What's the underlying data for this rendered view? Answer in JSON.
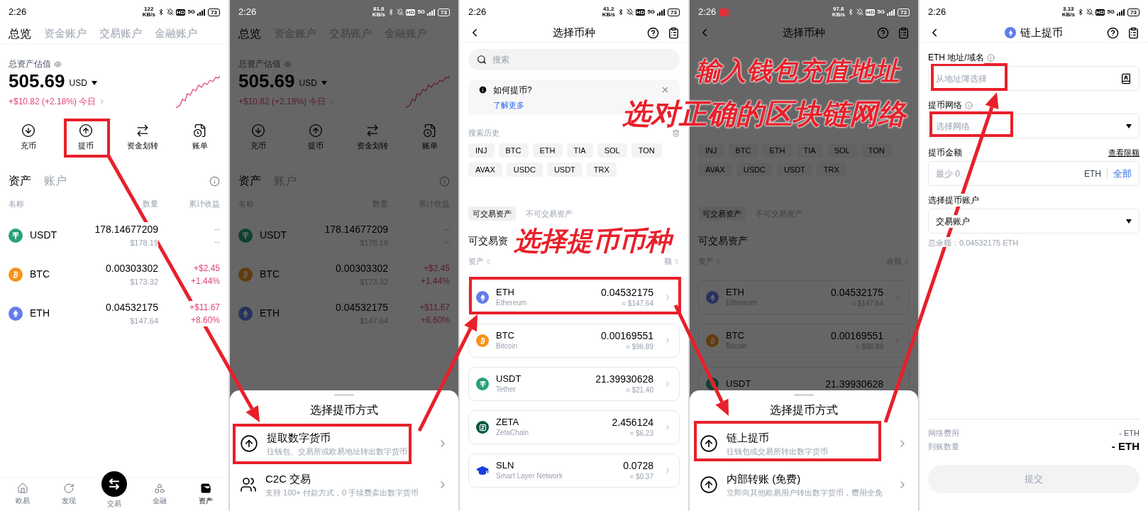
{
  "annotations": [
    {
      "text": "输入钱包充值地址"
    },
    {
      "text": "选对正确的区块链网络"
    },
    {
      "text": "选择提币币种"
    }
  ],
  "screens": [
    {
      "kind": "assets",
      "dimmed": false,
      "status_bar": {
        "time": "2:26",
        "notification": false,
        "speed": "122",
        "speed_unit": "KB/s",
        "hd": "HD",
        "network": "5G",
        "battery": "73"
      },
      "tabs": [
        {
          "label": "总览",
          "selected": true
        },
        {
          "label": "资金账户",
          "selected": false
        },
        {
          "label": "交易账户",
          "selected": false
        },
        {
          "label": "金融账户",
          "selected": false
        }
      ],
      "total_label": "总资产估值",
      "total_value": "505.69",
      "currency": "USD",
      "change": "+$10.82 (+2.18%) 今日",
      "actions": [
        {
          "label": "充币",
          "kind": "deposit"
        },
        {
          "label": "提币",
          "kind": "withdraw"
        },
        {
          "label": "资金划转",
          "kind": "transfer"
        },
        {
          "label": "账单",
          "kind": "bill"
        }
      ],
      "asset_tabs": [
        {
          "label": "资产",
          "selected": true
        },
        {
          "label": "账户",
          "selected": false
        }
      ],
      "columns": [
        "名称",
        "数量",
        "累计收益"
      ],
      "rows": [
        {
          "symbol": "USDT",
          "kind": "tether",
          "amount": "178.14677209",
          "value": "$178.19",
          "gain": false,
          "pnl": "--",
          "pnl_pct": "--"
        },
        {
          "symbol": "BTC",
          "kind": "bitcoin",
          "amount": "0.00303302",
          "value": "$173.32",
          "gain": true,
          "pnl": "+$2.45",
          "pnl_pct": "+1.44%"
        },
        {
          "symbol": "ETH",
          "kind": "ethereum",
          "amount": "0.04532175",
          "value": "$147.64",
          "gain": true,
          "pnl": "+$11.67",
          "pnl_pct": "+8.60%"
        }
      ],
      "bottom_nav": [
        {
          "label": "欧易",
          "kind": "home",
          "selected": false
        },
        {
          "label": "发现",
          "kind": "discover",
          "selected": false
        },
        {
          "label": "交易",
          "kind": "trade",
          "selected": false
        },
        {
          "label": "金融",
          "kind": "finance",
          "selected": false
        },
        {
          "label": "资产",
          "kind": "assets",
          "selected": true
        }
      ]
    },
    {
      "kind": "assets",
      "dimmed": true,
      "status_bar": {
        "time": "2:26",
        "notification": false,
        "speed": "81.8",
        "speed_unit": "KB/s",
        "hd": "HD",
        "network": "5G",
        "battery": "73"
      },
      "tabs": [
        {
          "label": "总览",
          "selected": true
        },
        {
          "label": "资金账户",
          "selected": false
        },
        {
          "label": "交易账户",
          "selected": false
        },
        {
          "label": "金融账户",
          "selected": false
        }
      ],
      "total_label": "总资产估值",
      "total_value": "505.69",
      "currency": "USD",
      "change": "+$10.82 (+2.18%) 今日",
      "actions": [
        {
          "label": "充币",
          "kind": "deposit"
        },
        {
          "label": "提币",
          "kind": "withdraw"
        },
        {
          "label": "资金划转",
          "kind": "transfer"
        },
        {
          "label": "账单",
          "kind": "bill"
        }
      ],
      "asset_tabs": [
        {
          "label": "资产",
          "selected": true
        },
        {
          "label": "账户",
          "selected": false
        }
      ],
      "columns": [
        "名称",
        "数量",
        "累计收益"
      ],
      "rows": [
        {
          "symbol": "USDT",
          "kind": "tether",
          "amount": "178.14677209",
          "value": "$178.19",
          "gain": false,
          "pnl": "--",
          "pnl_pct": "--"
        },
        {
          "symbol": "BTC",
          "kind": "bitcoin",
          "amount": "0.00303302",
          "value": "$173.32",
          "gain": true,
          "pnl": "+$2.45",
          "pnl_pct": "+1.44%"
        },
        {
          "symbol": "ETH",
          "kind": "ethereum",
          "amount": "0.04532175",
          "value": "$147.64",
          "gain": true,
          "pnl": "+$11.67",
          "pnl_pct": "+8.60%"
        }
      ],
      "sheet": {
        "title": "选择提币方式",
        "options": [
          {
            "kind": "upload",
            "title": "提取数字货币",
            "desc": "往钱包、交易所或欧易地址转出数字货币"
          },
          {
            "kind": "people",
            "title": "C2C 交易",
            "desc": "支持 100+ 付款方式，0 手续费卖出数字货币"
          }
        ]
      }
    },
    {
      "kind": "coin_select",
      "dimmed": false,
      "status_bar": {
        "time": "2:26",
        "notification": false,
        "speed": "41.2",
        "speed_unit": "KB/s",
        "hd": "HD",
        "network": "5G",
        "battery": "73"
      },
      "title": "选择币种",
      "search_placeholder": "搜索",
      "banner": {
        "title": "如何提币?",
        "link": "了解更多"
      },
      "history_label": "搜索历史",
      "chips": [
        "INJ",
        "BTC",
        "ETH",
        "TIA",
        "SOL",
        "TON",
        "AVAX",
        "USDC",
        "USDT",
        "TRX"
      ],
      "filters": [
        {
          "label": "可交易资产",
          "selected": true
        },
        {
          "label": "不可交易资产",
          "selected": false
        }
      ],
      "section_title": "可交易资",
      "columns": [
        "资产",
        "额"
      ],
      "coins": [
        {
          "symbol": "ETH",
          "name": "Ethereum",
          "kind": "ethereum",
          "amount": "0.04532175",
          "value": "≈ $147.64"
        },
        {
          "symbol": "BTC",
          "name": "Bitcoin",
          "kind": "bitcoin",
          "amount": "0.00169551",
          "value": "≈ $96.89"
        },
        {
          "symbol": "USDT",
          "name": "Tether",
          "kind": "tether",
          "amount": "21.39930628",
          "value": "≈ $21.40"
        },
        {
          "symbol": "ZETA",
          "name": "ZetaChain",
          "kind": "zeta",
          "amount": "2.456124",
          "value": "≈ $6.23"
        },
        {
          "symbol": "SLN",
          "name": "Smart Layer Network",
          "kind": "sln",
          "amount": "0.0728",
          "value": "≈ $0.37"
        }
      ]
    },
    {
      "kind": "coin_select",
      "dimmed": true,
      "status_bar": {
        "time": "2:26",
        "notification": true,
        "speed": "97.8",
        "speed_unit": "KB/s",
        "hd": "HD",
        "network": "5G",
        "battery": "73"
      },
      "title": "选择币种",
      "chips": [
        "INJ",
        "BTC",
        "ETH",
        "TIA",
        "SOL",
        "TON",
        "AVAX",
        "USDC",
        "USDT",
        "TRX"
      ],
      "filters": [
        {
          "label": "可交易资产",
          "selected": true
        },
        {
          "label": "不可交易资产",
          "selected": false
        }
      ],
      "section_title": "可交易资产",
      "columns": [
        "资产",
        "余额"
      ],
      "coins": [
        {
          "symbol": "ETH",
          "name": "Ethereum",
          "kind": "ethereum",
          "amount": "0.04532175",
          "value": "≈ $147.64"
        },
        {
          "symbol": "BTC",
          "name": "Bitcoin",
          "kind": "bitcoin",
          "amount": "0.00169551",
          "value": "≈ $96.89"
        },
        {
          "symbol": "USDT",
          "kind": "tether",
          "amount": "21.39930628"
        }
      ],
      "sheet": {
        "title": "选择提币方式",
        "options": [
          {
            "kind": "upload",
            "title": "链上提币",
            "desc": "往钱包或交易所转出数字货币"
          },
          {
            "kind": "upload",
            "title": "内部转账 (免费)",
            "desc": "立即向其他欧易用户转出数字货币，费用全免"
          }
        ]
      }
    },
    {
      "kind": "withdraw",
      "dimmed": false,
      "status_bar": {
        "time": "2:26",
        "notification": false,
        "speed": "3.13",
        "speed_unit": "KB/s",
        "hd": "HD",
        "network": "5G",
        "battery": "73"
      },
      "title": "链上提币",
      "fields": [
        {
          "kind": "address",
          "label": "ETH 地址/域名",
          "info": true,
          "placeholder": "从地址簿选择"
        },
        {
          "kind": "select",
          "label": "提币网络",
          "info": true,
          "placeholder": "选择网络"
        },
        {
          "kind": "amount",
          "label": "提币金额",
          "info": false,
          "link": "查看限额",
          "placeholder": "最少 0",
          "unit": "ETH",
          "action": "全部"
        },
        {
          "kind": "select",
          "label": "选择提币账户",
          "info": false,
          "value": "交易账户"
        }
      ],
      "balance": "总余额：0.04532175 ETH",
      "fee_rows": [
        {
          "label": "网络费用",
          "value": "- ETH",
          "emphasis": false
        },
        {
          "label": "到账数量",
          "value": "- ETH",
          "emphasis": true
        }
      ],
      "submit": {
        "label": "提交",
        "disabled": true
      }
    }
  ]
}
